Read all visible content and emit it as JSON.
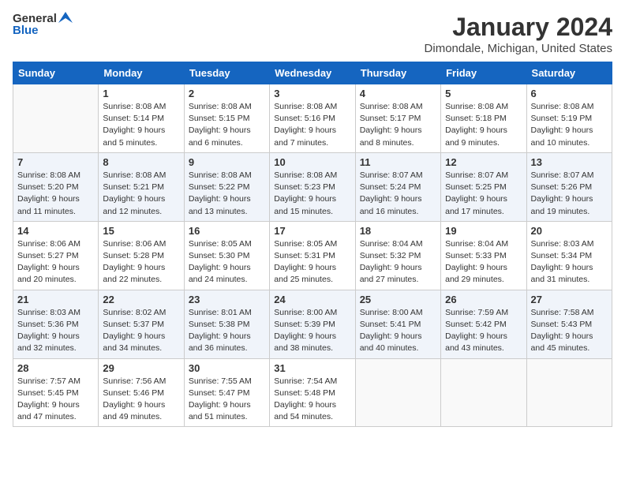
{
  "logo": {
    "line1": "General",
    "line2": "Blue"
  },
  "title": "January 2024",
  "subtitle": "Dimondale, Michigan, United States",
  "days_of_week": [
    "Sunday",
    "Monday",
    "Tuesday",
    "Wednesday",
    "Thursday",
    "Friday",
    "Saturday"
  ],
  "weeks": [
    [
      {
        "day": "",
        "detail": ""
      },
      {
        "day": "1",
        "detail": "Sunrise: 8:08 AM\nSunset: 5:14 PM\nDaylight: 9 hours\nand 5 minutes."
      },
      {
        "day": "2",
        "detail": "Sunrise: 8:08 AM\nSunset: 5:15 PM\nDaylight: 9 hours\nand 6 minutes."
      },
      {
        "day": "3",
        "detail": "Sunrise: 8:08 AM\nSunset: 5:16 PM\nDaylight: 9 hours\nand 7 minutes."
      },
      {
        "day": "4",
        "detail": "Sunrise: 8:08 AM\nSunset: 5:17 PM\nDaylight: 9 hours\nand 8 minutes."
      },
      {
        "day": "5",
        "detail": "Sunrise: 8:08 AM\nSunset: 5:18 PM\nDaylight: 9 hours\nand 9 minutes."
      },
      {
        "day": "6",
        "detail": "Sunrise: 8:08 AM\nSunset: 5:19 PM\nDaylight: 9 hours\nand 10 minutes."
      }
    ],
    [
      {
        "day": "7",
        "detail": "Sunrise: 8:08 AM\nSunset: 5:20 PM\nDaylight: 9 hours\nand 11 minutes."
      },
      {
        "day": "8",
        "detail": "Sunrise: 8:08 AM\nSunset: 5:21 PM\nDaylight: 9 hours\nand 12 minutes."
      },
      {
        "day": "9",
        "detail": "Sunrise: 8:08 AM\nSunset: 5:22 PM\nDaylight: 9 hours\nand 13 minutes."
      },
      {
        "day": "10",
        "detail": "Sunrise: 8:08 AM\nSunset: 5:23 PM\nDaylight: 9 hours\nand 15 minutes."
      },
      {
        "day": "11",
        "detail": "Sunrise: 8:07 AM\nSunset: 5:24 PM\nDaylight: 9 hours\nand 16 minutes."
      },
      {
        "day": "12",
        "detail": "Sunrise: 8:07 AM\nSunset: 5:25 PM\nDaylight: 9 hours\nand 17 minutes."
      },
      {
        "day": "13",
        "detail": "Sunrise: 8:07 AM\nSunset: 5:26 PM\nDaylight: 9 hours\nand 19 minutes."
      }
    ],
    [
      {
        "day": "14",
        "detail": "Sunrise: 8:06 AM\nSunset: 5:27 PM\nDaylight: 9 hours\nand 20 minutes."
      },
      {
        "day": "15",
        "detail": "Sunrise: 8:06 AM\nSunset: 5:28 PM\nDaylight: 9 hours\nand 22 minutes."
      },
      {
        "day": "16",
        "detail": "Sunrise: 8:05 AM\nSunset: 5:30 PM\nDaylight: 9 hours\nand 24 minutes."
      },
      {
        "day": "17",
        "detail": "Sunrise: 8:05 AM\nSunset: 5:31 PM\nDaylight: 9 hours\nand 25 minutes."
      },
      {
        "day": "18",
        "detail": "Sunrise: 8:04 AM\nSunset: 5:32 PM\nDaylight: 9 hours\nand 27 minutes."
      },
      {
        "day": "19",
        "detail": "Sunrise: 8:04 AM\nSunset: 5:33 PM\nDaylight: 9 hours\nand 29 minutes."
      },
      {
        "day": "20",
        "detail": "Sunrise: 8:03 AM\nSunset: 5:34 PM\nDaylight: 9 hours\nand 31 minutes."
      }
    ],
    [
      {
        "day": "21",
        "detail": "Sunrise: 8:03 AM\nSunset: 5:36 PM\nDaylight: 9 hours\nand 32 minutes."
      },
      {
        "day": "22",
        "detail": "Sunrise: 8:02 AM\nSunset: 5:37 PM\nDaylight: 9 hours\nand 34 minutes."
      },
      {
        "day": "23",
        "detail": "Sunrise: 8:01 AM\nSunset: 5:38 PM\nDaylight: 9 hours\nand 36 minutes."
      },
      {
        "day": "24",
        "detail": "Sunrise: 8:00 AM\nSunset: 5:39 PM\nDaylight: 9 hours\nand 38 minutes."
      },
      {
        "day": "25",
        "detail": "Sunrise: 8:00 AM\nSunset: 5:41 PM\nDaylight: 9 hours\nand 40 minutes."
      },
      {
        "day": "26",
        "detail": "Sunrise: 7:59 AM\nSunset: 5:42 PM\nDaylight: 9 hours\nand 43 minutes."
      },
      {
        "day": "27",
        "detail": "Sunrise: 7:58 AM\nSunset: 5:43 PM\nDaylight: 9 hours\nand 45 minutes."
      }
    ],
    [
      {
        "day": "28",
        "detail": "Sunrise: 7:57 AM\nSunset: 5:45 PM\nDaylight: 9 hours\nand 47 minutes."
      },
      {
        "day": "29",
        "detail": "Sunrise: 7:56 AM\nSunset: 5:46 PM\nDaylight: 9 hours\nand 49 minutes."
      },
      {
        "day": "30",
        "detail": "Sunrise: 7:55 AM\nSunset: 5:47 PM\nDaylight: 9 hours\nand 51 minutes."
      },
      {
        "day": "31",
        "detail": "Sunrise: 7:54 AM\nSunset: 5:48 PM\nDaylight: 9 hours\nand 54 minutes."
      },
      {
        "day": "",
        "detail": ""
      },
      {
        "day": "",
        "detail": ""
      },
      {
        "day": "",
        "detail": ""
      }
    ]
  ]
}
